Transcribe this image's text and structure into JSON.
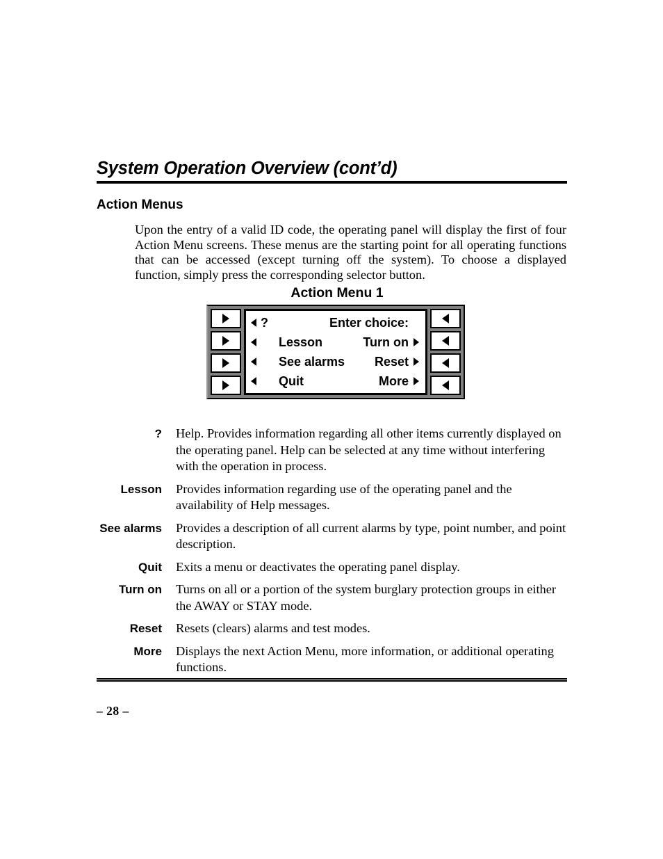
{
  "header": {
    "chapter_title": "System Operation Overview (cont’d)",
    "section_title": "Action Menus"
  },
  "intro": {
    "paragraph": "Upon the entry of a valid ID code, the operating panel will display the first of four Action Menu screens. These menus are the starting point for all operating functions that can be accessed (except turning off the system). To choose a displayed function, simply press the corresponding selector button."
  },
  "figure": {
    "caption": "Action Menu 1",
    "left_buttons": [
      {
        "name": "selector-button-left-1",
        "icon": "triangle-right-icon"
      },
      {
        "name": "selector-button-left-2",
        "icon": "triangle-right-icon"
      },
      {
        "name": "selector-button-left-3",
        "icon": "triangle-right-icon"
      },
      {
        "name": "selector-button-left-4",
        "icon": "triangle-right-icon"
      }
    ],
    "right_buttons": [
      {
        "name": "selector-button-right-1",
        "icon": "triangle-left-icon"
      },
      {
        "name": "selector-button-right-2",
        "icon": "triangle-left-icon"
      },
      {
        "name": "selector-button-right-3",
        "icon": "triangle-left-icon"
      },
      {
        "name": "selector-button-right-4",
        "icon": "triangle-left-icon"
      }
    ],
    "display_rows": [
      {
        "left_label": "?",
        "left_arrow": true,
        "right_label": "Enter choice:",
        "right_arrow": false
      },
      {
        "left_label": "Lesson",
        "left_arrow": true,
        "right_label": "Turn on",
        "right_arrow": true
      },
      {
        "left_label": "See alarms",
        "left_arrow": true,
        "right_label": "Reset",
        "right_arrow": true
      },
      {
        "left_label": "Quit",
        "left_arrow": true,
        "right_label": "More",
        "right_arrow": true
      }
    ]
  },
  "definitions": [
    {
      "term": "?",
      "description": "Help. Provides information regarding all other items currently displayed on the operating panel. Help can be selected at any time without interfering with the operation in process."
    },
    {
      "term": "Lesson",
      "description": "Provides information regarding use of the operating panel and the availability of Help messages."
    },
    {
      "term": "See alarms",
      "description": "Provides a description of all current alarms by type, point number, and point description."
    },
    {
      "term": "Quit",
      "description": "Exits a menu or deactivates the operating panel display."
    },
    {
      "term": "Turn on",
      "description": "Turns on all or a portion of the system burglary protection groups in either the AWAY or STAY mode."
    },
    {
      "term": "Reset",
      "description": "Resets (clears) alarms and test modes."
    },
    {
      "term": "More",
      "description": "Displays the next Action Menu, more information, or additional operating functions."
    }
  ],
  "footer": {
    "page_number": "– 28 –"
  },
  "colors": {
    "ink": "#000000",
    "paper": "#ffffff",
    "panel_frame": "#808080"
  }
}
